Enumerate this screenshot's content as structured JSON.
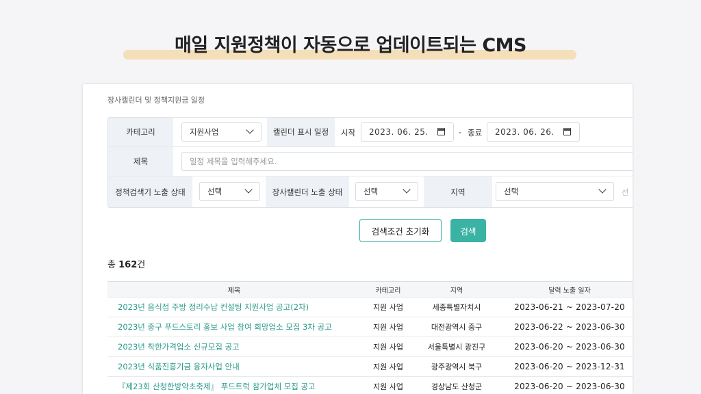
{
  "headline": "매일 지원정책이 자동으로 업데이트되는 CMS",
  "panel_title": "장사캘린더 및 정책지원금 일정",
  "filter": {
    "category_label": "카테고리",
    "category_value": "지원사업",
    "calendar_label": "캘린더 표시 일정",
    "start_label": "시작",
    "start_date": "2023. 06. 25.",
    "dash": "-",
    "end_label": "종료",
    "end_date": "2023. 06. 26.",
    "title_label": "제목",
    "title_placeholder": "일정 제목을 입력해주세요.",
    "policy_status_label": "정책검색기 노출 상태",
    "policy_status_value": "선택",
    "calendar_status_label": "장사캘린더 노출 상태",
    "calendar_status_value": "선택",
    "region_label": "지역",
    "region_value": "선택",
    "region_sub_value": "선"
  },
  "buttons": {
    "reset": "검색조건 초기화",
    "search": "검색"
  },
  "total": {
    "prefix": "총",
    "count": "162",
    "suffix": "건"
  },
  "table": {
    "headers": [
      "제목",
      "카테고리",
      "지역",
      "달력 노출 일자"
    ],
    "rows": [
      {
        "title": "2023년 음식점 주방 정리수납 컨설팅 지원사업 공고(2차)",
        "category": "지원 사업",
        "region": "세종특별자치시",
        "dates": "2023-06-21 ~ 2023-07-20"
      },
      {
        "title": "2023년 중구 푸드스토리 홍보 사업 참여 희망업소 모집 3차 공고",
        "category": "지원 사업",
        "region": "대전광역시 중구",
        "dates": "2023-06-22 ~ 2023-06-30"
      },
      {
        "title": "2023년 착한가격업소 신규모집 공고",
        "category": "지원 사업",
        "region": "서울특별시 광진구",
        "dates": "2023-06-20 ~ 2023-06-30"
      },
      {
        "title": "2023년 식품진흥기금 융자사업 안내",
        "category": "지원 사업",
        "region": "광주광역시 북구",
        "dates": "2023-06-20 ~ 2023-12-31"
      },
      {
        "title": "『제23회 산청한방약초축제』 푸드트럭 참가업체 모집 공고",
        "category": "지원 사업",
        "region": "경상남도 산청군",
        "dates": "2023-06-20 ~ 2023-06-30"
      }
    ]
  }
}
